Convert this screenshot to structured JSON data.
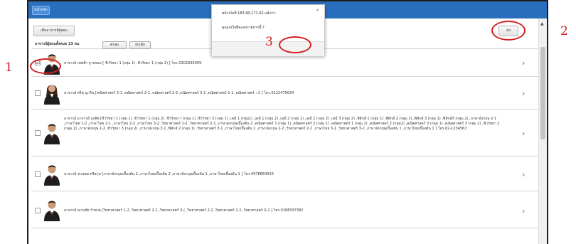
{
  "topbar": {
    "home_label": "หน้าหลัก",
    "accent": "#2a6fbd"
  },
  "toolbar": {
    "add_label": "เพิ่มอาจารย์ผู้สอน",
    "delete_label": "ลบ"
  },
  "list": {
    "count_label": "อาจารย์ผู้สอนทั้งหมด 13 คน",
    "rows": [
      {
        "checked": true,
        "avatar": "male",
        "text": "อาจารย์ เทพฟ้า ฐานทอง [ ชีววิทยา 1 (กลุ่ม 1) ,ชีววิทยา 1 (กลุ่ม 2) ] โทร.0302839009"
      },
      {
        "checked": false,
        "avatar": "female",
        "text": "อาจารย์ ศรีสุ ญาริน [คณิตศาสตร์ 3-1 ,คณิตศาสตร์ 2-1 ,คณิตศาสตร์ 2-2 ,คณิตศาสตร์ 3-2 ,คณิตศาสตร์ 1-1 ,คณิตศาสตร์ :-2 ] โทร.0122475634"
      },
      {
        "checked": false,
        "avatar": "male",
        "text": "อาจารย์ อาจารย์ ถุงทิพ [ชีววิทยา 1 (กลุ่ม 1) ,ชีววิทยา 1 (กลุ่ม 2) ,ชีววิทยา I (กลุ่ม 1) ,ชีววิทยา 3 (กลุ่ม 1) ,เคมี 1 (กลุ่ม1) ,เคมี 1 (กลุ่ม 2) ,เคมี 2 (กลุ่ม 1) ,เคมี 2 (กลุ่ม 2) ,เคมี 3 (กลุ่ม 2) ,ฟิสิกส์ 1 (กลุ่ม 1) ,ฟิสิกส์ 2 (กลุ่ม 1) ,ฟิสิกส์ 3 (กลุ่ม 1) ,ฟิสิกส์3 (กลุ่ม 2) ,ภาษาอังกฤษ 2-1 ,ภาษาไทย 1-2 ,ภาษาไทย 2-1 ,ภาษาไทย 2-2 ,ภาษาไทย 3-2 ,วิทยาศาสตร์ 1-2 ,วิทยาศาสตร์ 2-1 ,ภาษาอังกฤษเบื้องต้น 2 ,คณิตศาสตร์ 1 (กลุ่ม 1) ,คณิตศาสตร์ 2 (กลุ่ม 1) ,คณิตศาสตร์ 1 (กลุ่ม 2) ,คณิตศาสตร์ 2 (กลุ่ม2) ,คณิตศาสตร์ 3 (กลุ่ม 1) ,คณิตศาสตร์ 3 (กลุ่ม 2) ,ชีววิทยา 2 (กลุ่ม 2) ,ภาษาอังกฤษ 1-2 ,ชีววิทยา 3 (กลุ่ม 2) ,ภาษาอังกฤษ 3-1 ,ฟิสิกส์ 2 (กลุ่ม 1) ,วิทยาศาสตร์ 3-1 ,ภาษาไทยเบื้องต้น 2 ,ภาษาอังกฤษ 2-2 ,วิทยาศาสตร์ 2-2 ,ภาษาไทย 3-1 ,วิทยาศาสตร์ 3-2 ,ภาษาอังกฤษเบื้องต้น 1 ,ภาษาไทยเบื้องต้น 1 ] โทร.02-1234567"
      },
      {
        "checked": false,
        "avatar": "male",
        "text": "อาจารย์ ชวนชม ศรีสกุล [ภาษาอังกฤษเบื้องต้น 2 ,ภาษาไทยเบื้องต้น 2 ,ภาษาอังกฤษเบื้องต้น 1 ,ภาษาไทยเบื้องต้น 1 ] โทร.0978664533"
      },
      {
        "checked": false,
        "avatar": "male",
        "text": "อาจารย์ ฌานชัย รำพวย [วิทยาศาสตร์ 1-2 ,วิทยาศาสตร์ 2-1 ,วิทยาศาสตร์ 3-( ,วิทยาศาสตร์ 2-2 ,วิทยาศาสตร์ 1-1 ,วิทยาศาสตร์ 3-2 ] โทร.0188337382"
      }
    ]
  },
  "dialog": {
    "title": "หน้าเว็บที่ 183.90.171.62 แจ้งว่า:",
    "message": "คุณแน่ใจที่จะลบรายการนี้ ?",
    "ok_label": "ตกลง",
    "cancel_label": "ยกเลิก"
  },
  "annotations": {
    "labels": [
      "1",
      "2",
      "3"
    ],
    "color": "#d42020"
  }
}
